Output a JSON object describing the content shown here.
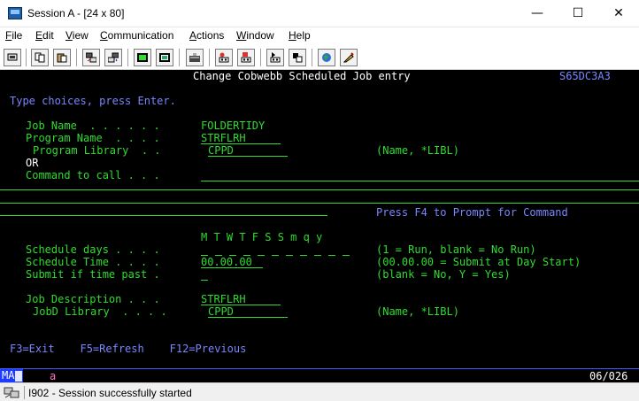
{
  "window": {
    "title": "Session A - [24 x 80]",
    "minimize_glyph": "—",
    "maximize_glyph": "☐",
    "close_glyph": "✕"
  },
  "menu": {
    "items": [
      {
        "label": "File",
        "accel": "F",
        "rest": "ile"
      },
      {
        "label": "Edit",
        "accel": "E",
        "rest": "dit"
      },
      {
        "label": "View",
        "accel": "V",
        "rest": "iew"
      },
      {
        "label": "Communication",
        "accel": "C",
        "rest": "ommunication"
      },
      {
        "label": "Actions",
        "accel": "A",
        "rest": "ctions"
      },
      {
        "label": "Window",
        "accel": "W",
        "rest": "indow"
      },
      {
        "label": "Help",
        "accel": "H",
        "rest": "elp"
      }
    ]
  },
  "toolbar": {
    "icons": [
      "print-screen-icon",
      "copy-icon",
      "paste-icon",
      "send-file-icon",
      "receive-file-icon",
      "display-keypad-icon",
      "keypad-icon",
      "macro-record-icon",
      "macro-play-icon",
      "macro-stop-icon",
      "macro-run-icon",
      "settings-icon",
      "support-icon",
      "customize-icon"
    ]
  },
  "terminal": {
    "title": "Change Cobwebb Scheduled Job entry",
    "screen_id": "S65DC3A3",
    "instruction": "Type choices, press Enter.",
    "job_name_label": "Job Name  . . . . . .",
    "job_name_value": "FOLDERTIDY",
    "program_name_label": "Program Name  . . . .",
    "program_name_value": "STRFLRH",
    "program_library_label": "Program Library  . .",
    "program_library_value": "CPPD",
    "program_library_hint": "(Name, *LIBL)",
    "or_label": "OR",
    "command_label": "Command to call . . .",
    "command_value": "",
    "f4_hint": "Press F4 to Prompt for Command",
    "days_header": "M T W T F S S m q y",
    "schedule_days_label": "Schedule days . . . .",
    "schedule_days_hint": "(1 = Run, blank = No Run)",
    "schedule_time_label": "Schedule Time . . . .",
    "schedule_time_value": "00.00.00",
    "schedule_time_hint": "(00.00.00 = Submit at Day Start)",
    "submit_past_label": "Submit if time past .",
    "submit_past_value": "",
    "submit_past_hint": "(blank = No, Y = Yes)",
    "job_desc_label": "Job Description . . .",
    "job_desc_value": "STRFLRH",
    "jobd_library_label": "JobD Library  . . . .",
    "jobd_library_value": "CPPD",
    "jobd_library_hint": "(Name, *LIBL)",
    "function_keys": "F3=Exit    F5=Refresh    F12=Previous"
  },
  "oia": {
    "indicator": "MA",
    "mode": "a",
    "cursor_position": "06/026"
  },
  "status": {
    "message": "I902 - Session successfully started"
  },
  "colors": {
    "terminal_bg": "#000000",
    "green": "#2fdc2f",
    "blue": "#7a86ff",
    "pink": "#ff73c8",
    "oia_blue": "#1e3cff"
  }
}
